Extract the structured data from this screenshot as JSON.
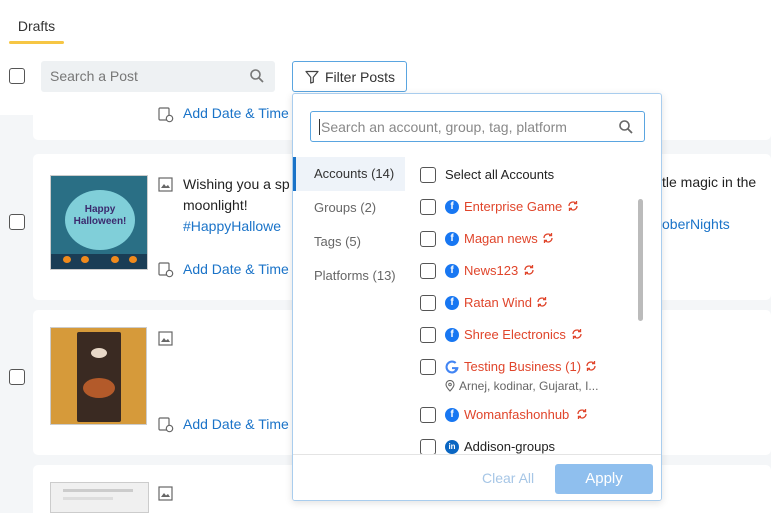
{
  "tabs": {
    "drafts": "Drafts"
  },
  "toolbar": {
    "search_placeholder": "Search a Post",
    "filter_label": "Filter Posts"
  },
  "posts": [
    {
      "add_date_time": "Add Date & Time"
    },
    {
      "text": "Wishing you a sp",
      "text_line2": "moonlight!",
      "hashtag": "#HappyHallowe",
      "right_clip": "tle magic in the",
      "right_hashtag": "oberNights",
      "add_date_time": "Add Date & Time",
      "thumb_caption": "Happy Halloween!"
    },
    {
      "add_date_time": "Add Date & Time"
    },
    {}
  ],
  "filter": {
    "search_placeholder": "Search an account, group, tag, platform",
    "categories": [
      {
        "label": "Accounts (14)"
      },
      {
        "label": "Groups (2)"
      },
      {
        "label": "Tags (5)"
      },
      {
        "label": "Platforms (13)"
      }
    ],
    "select_all": "Select all Accounts",
    "accounts": [
      {
        "name": "Enterprise Game",
        "platform": "facebook-icon"
      },
      {
        "name": "Magan news",
        "platform": "facebook-icon"
      },
      {
        "name": "News123",
        "platform": "facebook-icon"
      },
      {
        "name": "Ratan Wind",
        "platform": "facebook-icon"
      },
      {
        "name": "Shree Electronics",
        "platform": "facebook-icon"
      },
      {
        "name": "Testing Business (1)",
        "platform": "google-icon",
        "location": "Arnej, kodinar, Gujarat, I..."
      },
      {
        "name": "Womanfashonhub",
        "platform": "facebook-icon"
      },
      {
        "name": "Addison-groups",
        "platform": "linkedin-icon"
      }
    ],
    "clear_all": "Clear All",
    "apply": "Apply"
  },
  "colors": {
    "accent": "#1a73c8",
    "error_red": "#e0452b",
    "tab_underline": "#f6c644",
    "apply_disabled": "#8fbfee"
  }
}
